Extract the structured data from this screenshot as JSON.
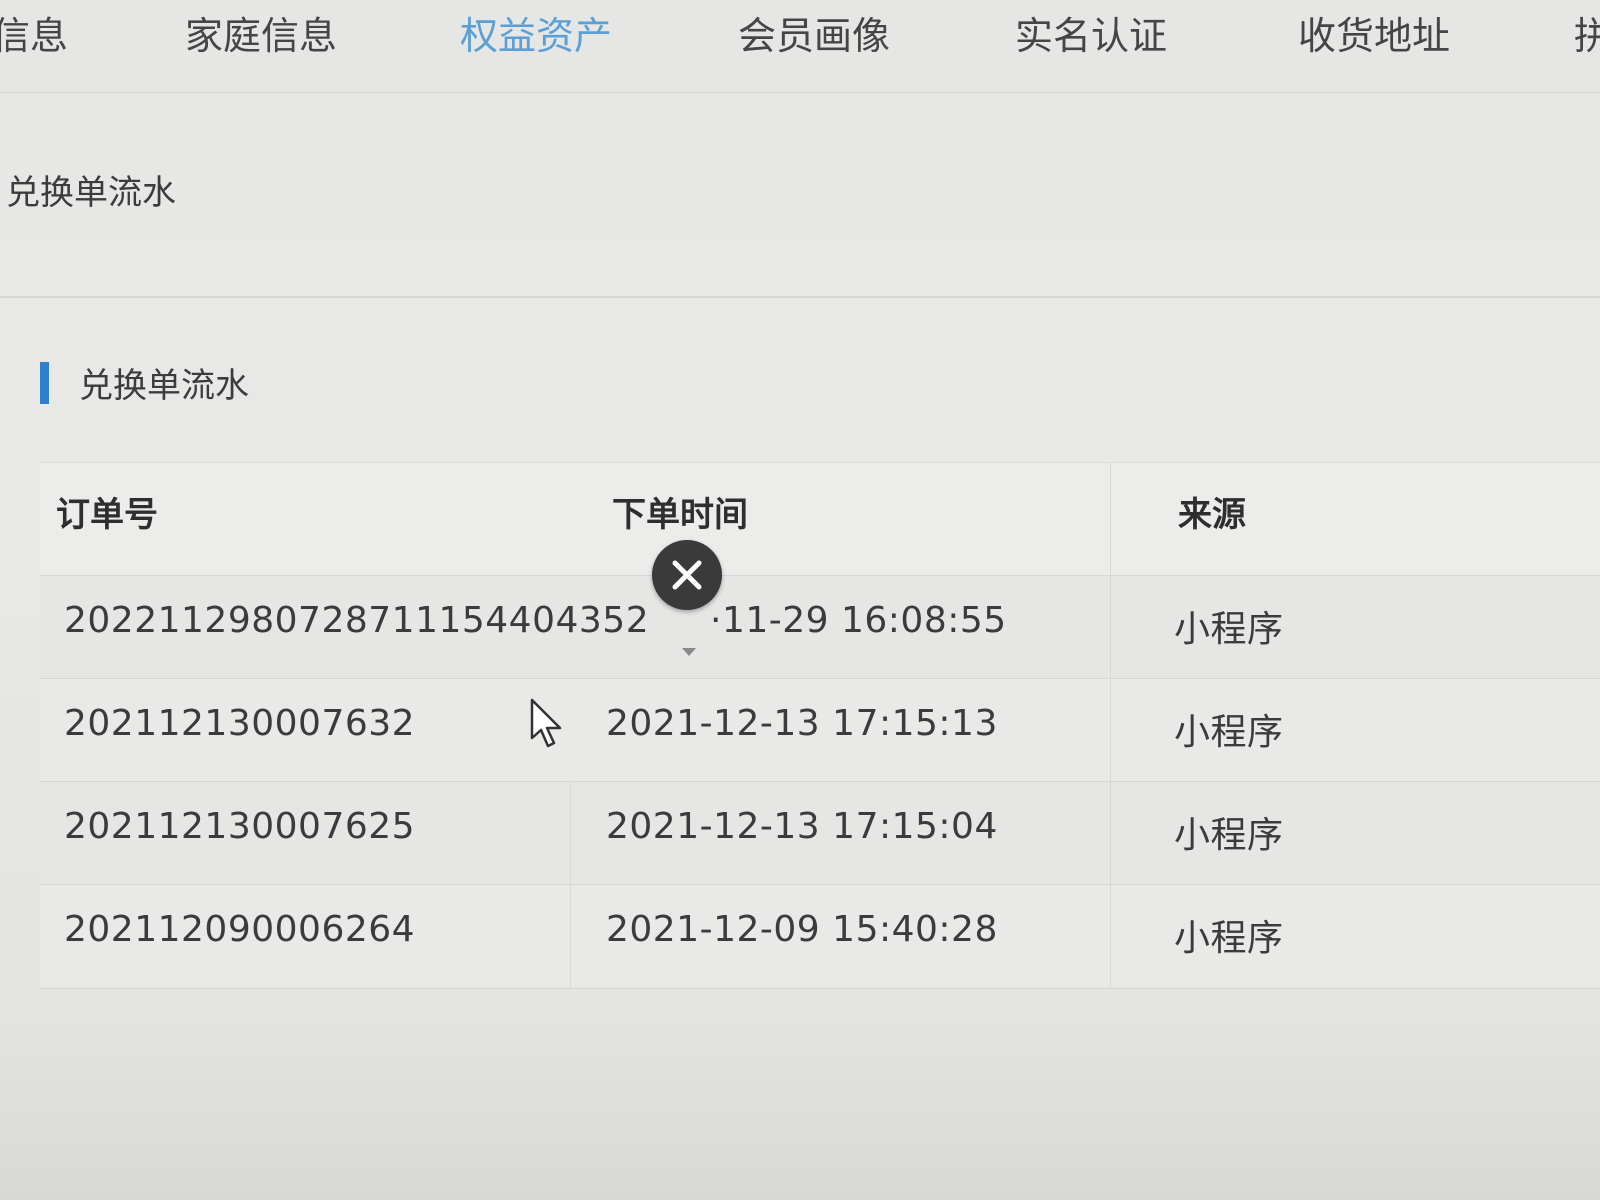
{
  "tabs": [
    {
      "label": "信息",
      "active": false
    },
    {
      "label": "家庭信息",
      "active": false
    },
    {
      "label": "权益资产",
      "active": true
    },
    {
      "label": "会员画像",
      "active": false
    },
    {
      "label": "实名认证",
      "active": false
    },
    {
      "label": "收货地址",
      "active": false
    },
    {
      "label": "拼",
      "active": false
    }
  ],
  "breadcrumb": "兑换单流水",
  "section": {
    "title": "兑换单流水"
  },
  "table": {
    "columns": [
      "订单号",
      "下单时间",
      "来源"
    ],
    "rows": [
      {
        "order_id": "202211298072871115440435​2",
        "order_time": "·11-29 16:08:55",
        "source": "小程序"
      },
      {
        "order_id": "202112130007632",
        "order_time": "2021-12-13 17:15:13",
        "source": "小程序"
      },
      {
        "order_id": "202112130007625",
        "order_time": "2021-12-13 17:15:04",
        "source": "小程序"
      },
      {
        "order_id": "202112090006264",
        "order_time": "2021-12-09 15:40:28",
        "source": "小程序"
      }
    ]
  },
  "colors": {
    "active_tab": "#5a9fd6",
    "accent_bar": "#2f7fd0",
    "close_button_bg": "#3a3a3a"
  },
  "icons": {
    "close": "close-icon",
    "cursor": "mouse-pointer-icon"
  }
}
